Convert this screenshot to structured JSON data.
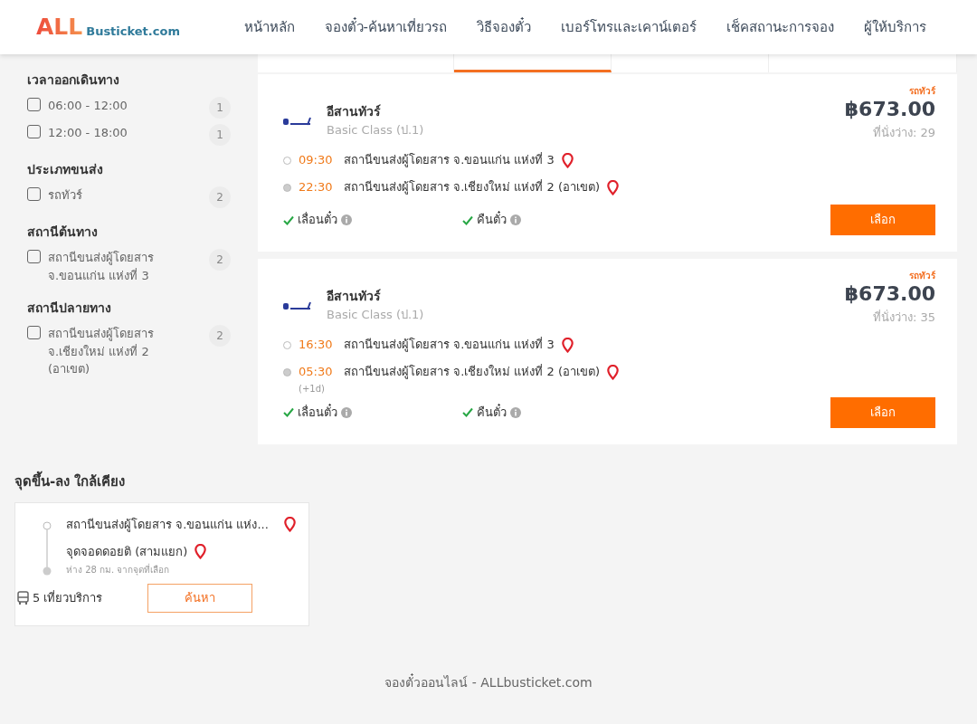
{
  "header": {
    "logo": {
      "part_1": "ALL",
      "part_2": "Busticket.com"
    },
    "nav": [
      {
        "label": "หน้าหลัก"
      },
      {
        "label": "จองตั๋ว-ค้นหาเที่ยวรถ"
      },
      {
        "label": "วิธีจองตั๋ว"
      },
      {
        "label": "เบอร์โทรและเคาน์เตอร์"
      },
      {
        "label": "เช็คสถานะการจอง"
      },
      {
        "label": "ผู้ให้บริการ"
      }
    ]
  },
  "filters": [
    {
      "title": "เวลาออกเดินทาง",
      "options": [
        {
          "label": "06:00 - 12:00",
          "count": "1",
          "checked": false
        },
        {
          "label": "12:00 - 18:00",
          "count": "1",
          "checked": false
        }
      ]
    },
    {
      "title": "ประเภทขนส่ง",
      "options": [
        {
          "label": "รถทัวร์",
          "count": "2",
          "checked": false
        }
      ]
    },
    {
      "title": "สถานีต้นทาง",
      "options": [
        {
          "label": "สถานีขนส่งผู้โดยสาร จ.ขอนแก่น แห่งที่ 3",
          "count": "2",
          "checked": false
        }
      ]
    },
    {
      "title": "สถานีปลายทาง",
      "options": [
        {
          "label": "สถานีขนส่งผู้โดยสาร จ.เชียงใหม่ แห่งที่ 2 (อาเขต)",
          "count": "2",
          "checked": false
        }
      ]
    }
  ],
  "sort_tabs": [
    {
      "selected": false
    },
    {
      "selected": true
    },
    {
      "selected": false
    },
    {
      "selected": false
    }
  ],
  "trips": [
    {
      "tag": "รถทัวร์",
      "operator": "อีสานทัวร์",
      "class": "Basic Class (ป.1)",
      "price": "฿673.00",
      "seats": "ที่นั่งว่าง: 29",
      "stops": [
        {
          "time": "09:30",
          "station": "สถานีขนส่งผู้โดยสาร จ.ขอนแก่น แห่งที่ 3"
        },
        {
          "time": "22:30",
          "station": "สถานีขนส่งผู้โดยสาร จ.เชียงใหม่ แห่งที่ 2 (อาเขต)"
        }
      ],
      "policies": [
        {
          "label": "เลื่อนตั๋ว"
        },
        {
          "label": "คืนตั๋ว"
        }
      ],
      "button": "เลือก"
    },
    {
      "tag": "รถทัวร์",
      "operator": "อีสานทัวร์",
      "class": "Basic Class (ป.1)",
      "price": "฿673.00",
      "seats": "ที่นั่งว่าง: 35",
      "stops": [
        {
          "time": "16:30",
          "station": "สถานีขนส่งผู้โดยสาร จ.ขอนแก่น แห่งที่ 3"
        },
        {
          "time": "05:30",
          "station": "สถานีขนส่งผู้โดยสาร จ.เชียงใหม่ แห่งที่ 2 (อาเขต)",
          "note": "(+1d)"
        }
      ],
      "policies": [
        {
          "label": "เลื่อนตั๋ว"
        },
        {
          "label": "คืนตั๋ว"
        }
      ],
      "button": "เลือก"
    }
  ],
  "nearby": {
    "title": "จุดขึ้น-ลง ใกล้เคียง",
    "cards": [
      {
        "from": "สถานีขนส่งผู้โดยสาร จ.ขอนแก่น แห่ง...",
        "to": "จุดจอดดอยติ (สามแยก)",
        "distance": "ห่าง 28 กม. จากจุดที่เลือก",
        "trips": "5 เที่ยวบริการ",
        "button": "ค้นหา"
      }
    ]
  },
  "footer": "จองตั๋วออนไลน์ - ALLbusticket.com"
}
